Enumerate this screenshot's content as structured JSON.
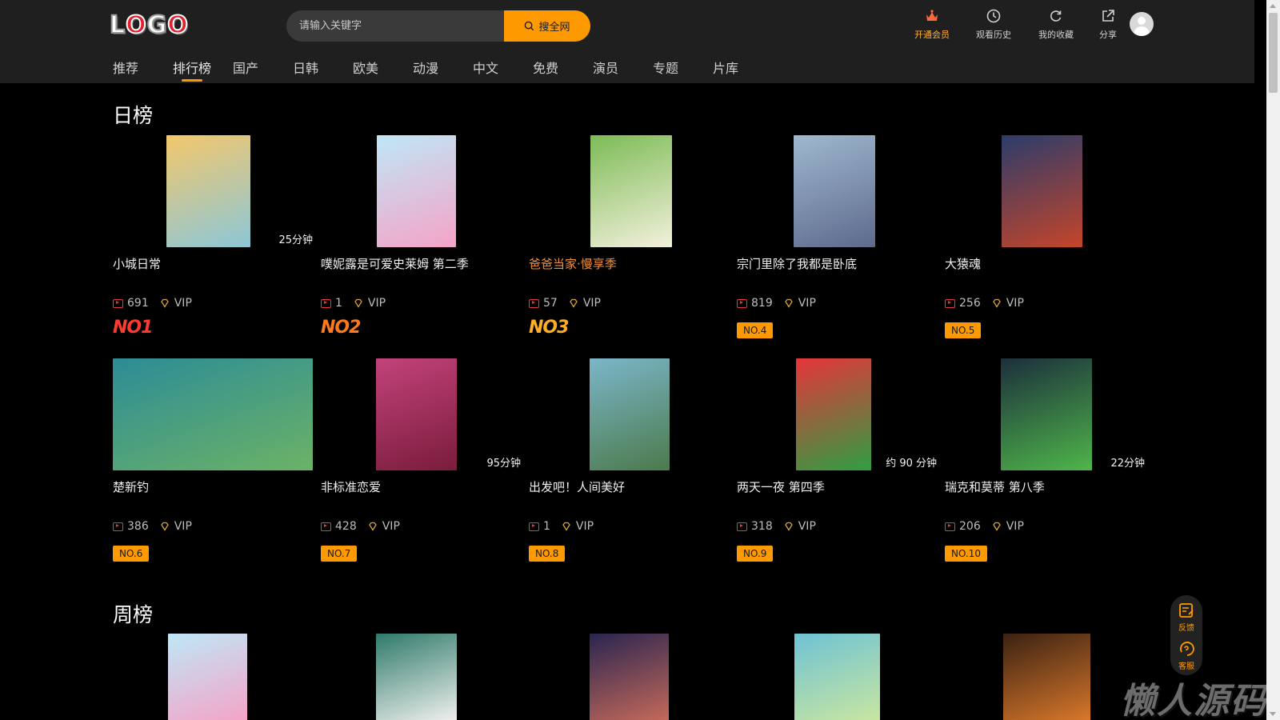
{
  "header": {
    "logo": "LOGO",
    "search_placeholder": "请输入关键字",
    "search_button": "搜全网",
    "actions": [
      {
        "label": "开通会员",
        "icon": "crown-icon"
      },
      {
        "label": "观看历史",
        "icon": "clock-icon"
      },
      {
        "label": "我的收藏",
        "icon": "refresh-heart-icon"
      },
      {
        "label": "分享",
        "icon": "share-icon"
      }
    ]
  },
  "nav": [
    "推荐",
    "排行榜",
    "国产",
    "日韩",
    "欧美",
    "动漫",
    "中文",
    "免费",
    "演员",
    "专题",
    "片库"
  ],
  "nav_active": "排行榜",
  "daily": {
    "title": "日榜",
    "items": [
      {
        "title": "小城日常",
        "duration": "25分钟",
        "count": "691",
        "vip": "VIP",
        "rank": "NO1",
        "colors": [
          "#f3c76c",
          "#8cc7d8"
        ]
      },
      {
        "title": "噗妮露是可爱史莱姆 第二季",
        "duration": "",
        "count": "1",
        "vip": "VIP",
        "rank": "NO2",
        "colors": [
          "#bfe7f7",
          "#f5a3c7"
        ]
      },
      {
        "title": "爸爸当家·慢享季",
        "duration": "",
        "count": "57",
        "vip": "VIP",
        "rank": "NO3",
        "colors": [
          "#7dbb56",
          "#f3f0dc"
        ]
      },
      {
        "title": "宗门里除了我都是卧底",
        "duration": "",
        "count": "819",
        "vip": "VIP",
        "rank": "NO.4",
        "colors": [
          "#9fb8cf",
          "#5e6a8c"
        ]
      },
      {
        "title": "大猿魂",
        "duration": "",
        "count": "256",
        "vip": "VIP",
        "rank": "NO.5",
        "colors": [
          "#2c3c6b",
          "#c4452a"
        ]
      },
      {
        "title": "楚新钓",
        "duration": "",
        "count": "386",
        "vip": "VIP",
        "rank": "NO.6",
        "colors": [
          "#2c8c96",
          "#6cb267"
        ]
      },
      {
        "title": "非标准恋爱",
        "duration": "95分钟",
        "count": "428",
        "vip": "VIP",
        "rank": "NO.7",
        "colors": [
          "#c2437a",
          "#7a1c3c"
        ]
      },
      {
        "title": "出发吧！人间美好",
        "duration": "",
        "count": "1",
        "vip": "VIP",
        "rank": "NO.8",
        "colors": [
          "#7bb6c9",
          "#4c7a4c"
        ]
      },
      {
        "title": "两天一夜 第四季",
        "duration": "约 90 分钟",
        "count": "318",
        "vip": "VIP",
        "rank": "NO.9",
        "colors": [
          "#e6343a",
          "#2f9e43"
        ]
      },
      {
        "title": "瑞克和莫蒂 第八季",
        "duration": "22分钟",
        "count": "206",
        "vip": "VIP",
        "rank": "NO.10",
        "colors": [
          "#1c2f3c",
          "#4fb54a"
        ]
      }
    ]
  },
  "weekly": {
    "title": "周榜",
    "items": [
      {
        "colors": [
          "#bfe7f7",
          "#f5a3c7"
        ]
      },
      {
        "colors": [
          "#2f7a6a",
          "#f1f1ef"
        ]
      },
      {
        "colors": [
          "#2a2550",
          "#c66a5a"
        ]
      },
      {
        "colors": [
          "#6fc2d4",
          "#c9e6a0"
        ]
      },
      {
        "colors": [
          "#3b2212",
          "#d9782b"
        ]
      }
    ]
  },
  "float": [
    {
      "label": "反馈",
      "icon": "feedback-icon"
    },
    {
      "label": "客服",
      "icon": "customer-service-icon"
    }
  ],
  "watermark": "懒人源码"
}
